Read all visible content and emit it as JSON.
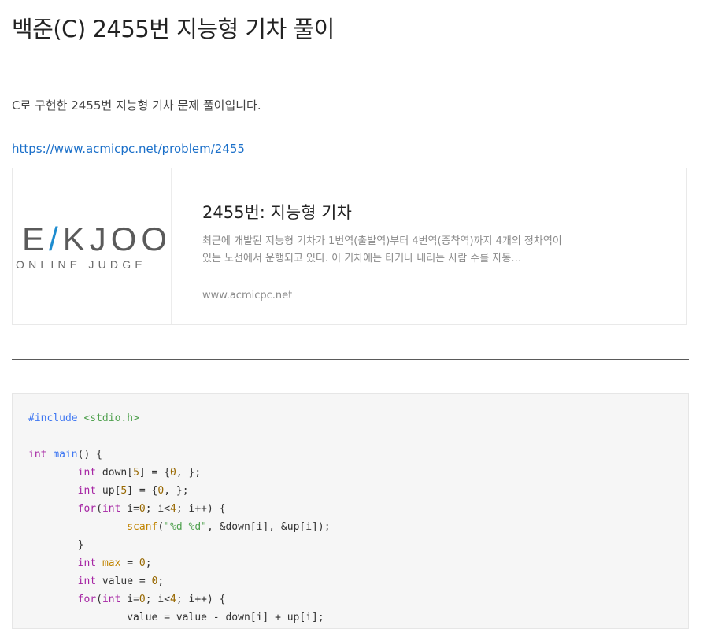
{
  "post": {
    "title": "백준(C) 2455번 지능형 기차 풀이",
    "intro": "C로 구현한 2455번 지능형 기차 문제 풀이입니다.",
    "link_text": "https://www.acmicpc.net/problem/2455"
  },
  "card": {
    "logo_main": "E/KJOO",
    "logo_sub": "ONLINE JUDGE",
    "title": "2455번: 지능형 기차",
    "description": "최근에 개발된 지능형 기차가 1번역(출발역)부터 4번역(종착역)까지 4개의 정차역이 있는 노선에서 운행되고 있다. 이 기차에는 타거나 내리는 사람 수를 자동…",
    "domain": "www.acmicpc.net"
  },
  "code": {
    "language": "c",
    "lines": [
      "#include <stdio.h>",
      "",
      "int main() {",
      "\tint down[5] = {0, };",
      "\tint up[5] = {0, };",
      "\tfor(int i=0; i<4; i++) {",
      "\t\tscanf(\"%d %d\", &down[i], &up[i]);",
      "\t}",
      "\tint max = 0;",
      "\tint value = 0;",
      "\tfor(int i=0; i<4; i++) {",
      "\t\tvalue = value - down[i] + up[i];"
    ]
  }
}
